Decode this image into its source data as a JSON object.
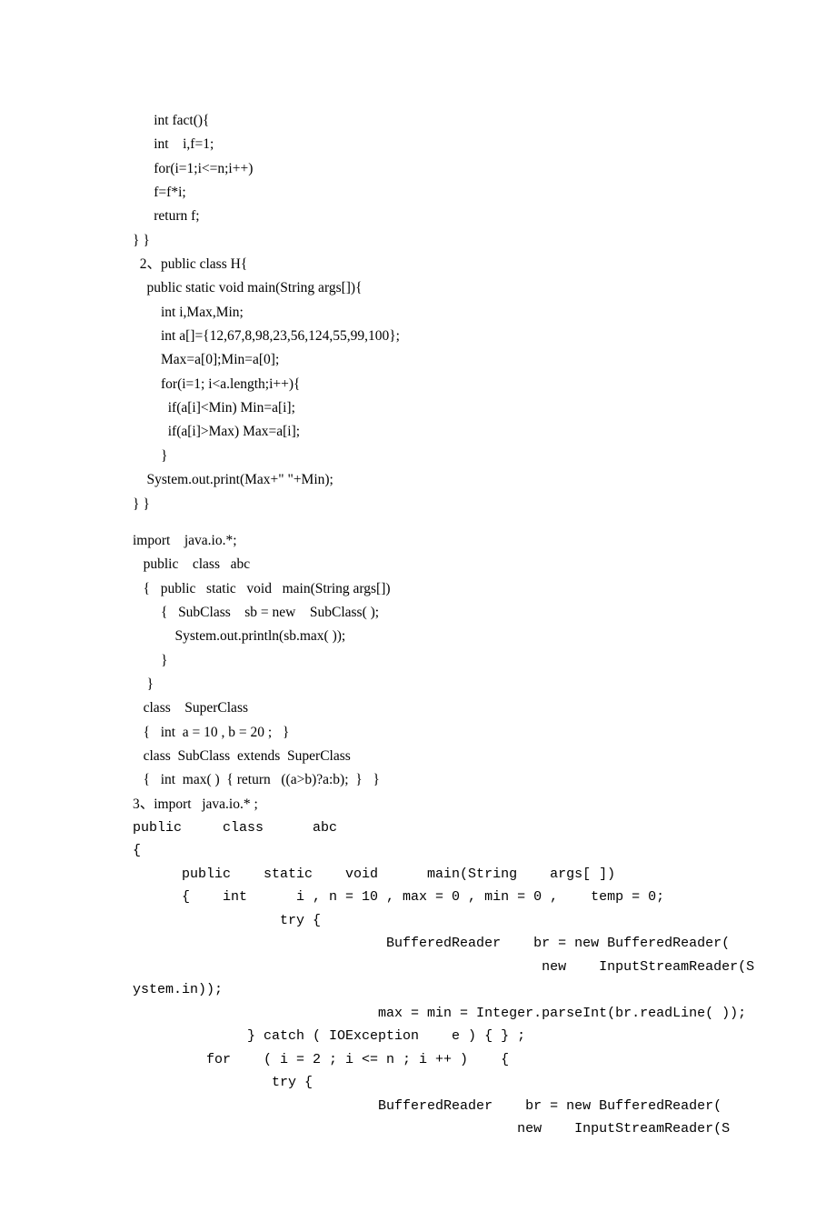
{
  "lines": [
    {
      "cls": "line",
      "text": "      int fact(){"
    },
    {
      "cls": "line",
      "text": "      int    i,f=1;"
    },
    {
      "cls": "line",
      "text": "      for(i=1;i<=n;i++)"
    },
    {
      "cls": "line",
      "text": "      f=f*i;"
    },
    {
      "cls": "line",
      "text": "      return f;"
    },
    {
      "cls": "line",
      "text": "} }"
    },
    {
      "cls": "line",
      "text": "  2、public class H{"
    },
    {
      "cls": "line",
      "text": "    public static void main(String args[]){"
    },
    {
      "cls": "line",
      "text": "        int i,Max,Min;"
    },
    {
      "cls": "line",
      "text": "        int a[]={12,67,8,98,23,56,124,55,99,100};"
    },
    {
      "cls": "line",
      "text": "        Max=a[0];Min=a[0];"
    },
    {
      "cls": "line",
      "text": "        for(i=1; i<a.length;i++){"
    },
    {
      "cls": "line",
      "text": "          if(a[i]<Min) Min=a[i];"
    },
    {
      "cls": "line",
      "text": "          if(a[i]>Max) Max=a[i];"
    },
    {
      "cls": "line",
      "text": "        }"
    },
    {
      "cls": "line",
      "text": "    System.out.print(Max+\" \"+Min);"
    },
    {
      "cls": "line",
      "text": "} }"
    },
    {
      "cls": "gap",
      "text": ""
    },
    {
      "cls": "line",
      "text": "import    java.io.*;"
    },
    {
      "cls": "line",
      "text": "   public    class   abc"
    },
    {
      "cls": "line",
      "text": "   {   public   static   void   main(String args[])"
    },
    {
      "cls": "line",
      "text": "        {   SubClass    sb = new    SubClass( );"
    },
    {
      "cls": "line",
      "text": "            System.out.println(sb.max( ));"
    },
    {
      "cls": "line",
      "text": "        }"
    },
    {
      "cls": "line",
      "text": "    }"
    },
    {
      "cls": "line",
      "text": "   class    SuperClass"
    },
    {
      "cls": "line",
      "text": "   {   int  a = 10 , b = 20 ;   }"
    },
    {
      "cls": "line",
      "text": "   class  SubClass  extends  SuperClass"
    },
    {
      "cls": "line",
      "text": "   {   int  max( )  { return   ((a>b)?a:b);  }   }"
    },
    {
      "cls": "line",
      "text": "3、import   java.io.* ;"
    },
    {
      "cls": "line mono",
      "text": "public     class      abc"
    },
    {
      "cls": "line mono",
      "text": "{"
    },
    {
      "cls": "line mono",
      "text": "      public    static    void      main(String    args[ ])"
    },
    {
      "cls": "line mono",
      "text": "      {    int      i , n = 10 , max = 0 , min = 0 ,    temp = 0;"
    },
    {
      "cls": "line mono",
      "text": "                  try {"
    },
    {
      "cls": "line mono",
      "text": "                               BufferedReader    br = new BufferedReader("
    },
    {
      "cls": "line mono",
      "text": "                                                  new    InputStreamReader(S"
    },
    {
      "cls": "line mono",
      "text": "ystem.in));"
    },
    {
      "cls": "line mono",
      "text": "                              max = min = Integer.parseInt(br.readLine( ));"
    },
    {
      "cls": "line mono",
      "text": "              } catch ( IOException    e ) { } ;"
    },
    {
      "cls": "line mono",
      "text": "         for    ( i = 2 ; i <= n ; i ++ )    {"
    },
    {
      "cls": "line mono",
      "text": "                 try {"
    },
    {
      "cls": "line mono",
      "text": "                              BufferedReader    br = new BufferedReader("
    },
    {
      "cls": "line mono",
      "text": "                                               new    InputStreamReader(S"
    }
  ]
}
